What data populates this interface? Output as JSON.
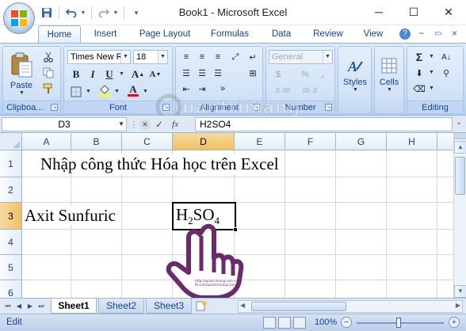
{
  "window": {
    "title": "Book1 - Microsoft Excel",
    "controls": {
      "minimize": "─",
      "restore": "☐",
      "close": "✕"
    }
  },
  "qat": {
    "save_icon": "save-icon",
    "undo_icon": "undo-icon",
    "redo_icon": "redo-icon",
    "customize_icon": "customize-icon"
  },
  "tabs": [
    {
      "label": "Home",
      "active": true
    },
    {
      "label": "Insert"
    },
    {
      "label": "Page Layout"
    },
    {
      "label": "Formulas"
    },
    {
      "label": "Data"
    },
    {
      "label": "Review"
    },
    {
      "label": "View"
    }
  ],
  "ribbon": {
    "clipboard": {
      "label": "Clipboa...",
      "paste": "Paste"
    },
    "font": {
      "label": "Font",
      "name": "Times New Ro",
      "size": "18",
      "bold": "B",
      "italic": "I",
      "underline": "U",
      "font_color": "#ff0000"
    },
    "alignment": {
      "label": "Alignment"
    },
    "number": {
      "label": "Number",
      "format": "General",
      "currency": "$",
      "percent": "%",
      "comma": ",",
      "inc_decimal": ".0 .00",
      "dec_decimal": ".00 .0"
    },
    "styles": {
      "label": "Styles"
    },
    "cells": {
      "label": "Cells"
    },
    "editing": {
      "label": "Editing",
      "sum": "Σ"
    }
  },
  "formula_bar": {
    "name_box": "D3",
    "fx": "fx",
    "formula": "H2SO4"
  },
  "grid": {
    "columns": [
      "A",
      "B",
      "C",
      "D",
      "E",
      "F",
      "G",
      "H"
    ],
    "selected_column": "D",
    "rows": [
      "1",
      "2",
      "3",
      "4",
      "5",
      "6"
    ],
    "selected_row": "3",
    "cells": {
      "A1": "Nhập công thức Hóa học trên Excel",
      "A3": "Axit Sunfuric",
      "D3": {
        "h": "H",
        "sub1": "2",
        "so": "SO",
        "sub2": "4"
      }
    }
  },
  "sheets": [
    {
      "label": "Sheet1",
      "active": true
    },
    {
      "label": "Sheet2"
    },
    {
      "label": "Sheet3"
    }
  ],
  "status": {
    "mode": "Edit",
    "zoom": "100%"
  },
  "watermark": {
    "text": "uantrimang",
    "hand_caption_1": "http://quantrimang.com.vn",
    "hand_caption_2": "fb.com/quantrimang.com.vn"
  },
  "colors": {
    "accent": "#15428b",
    "ribbon": "#c5daf3",
    "selected_header": "#f1c15f",
    "hand": "#6b2a6e"
  }
}
